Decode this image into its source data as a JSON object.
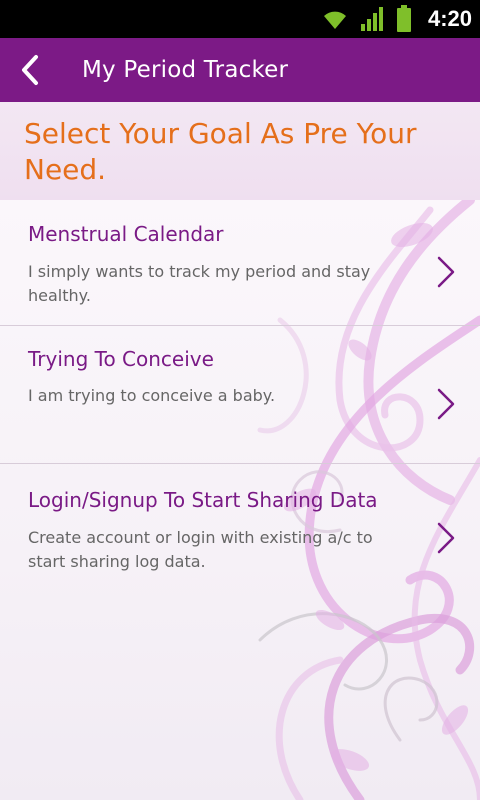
{
  "status_bar": {
    "time": "4:20",
    "icons": [
      "wifi-icon",
      "signal-icon",
      "battery-icon"
    ]
  },
  "app_bar": {
    "title": "My Period Tracker",
    "back_icon": "chevron-left-icon"
  },
  "goal_header": {
    "title": "Select Your Goal As Pre Your Need."
  },
  "options": [
    {
      "title": "Menstrual Calendar",
      "description": "I simply wants to track my period and stay healthy."
    },
    {
      "title": "Trying To Conceive",
      "description": "I am trying to conceive a baby."
    },
    {
      "title": "Login/Signup To Start Sharing Data",
      "description": "Create account or login with existing a/c to start sharing log data."
    }
  ],
  "colors": {
    "app_bar": "#7c1a86",
    "goal_title": "#e56f1b",
    "option_title": "#7a1a86",
    "option_desc": "#666666"
  }
}
